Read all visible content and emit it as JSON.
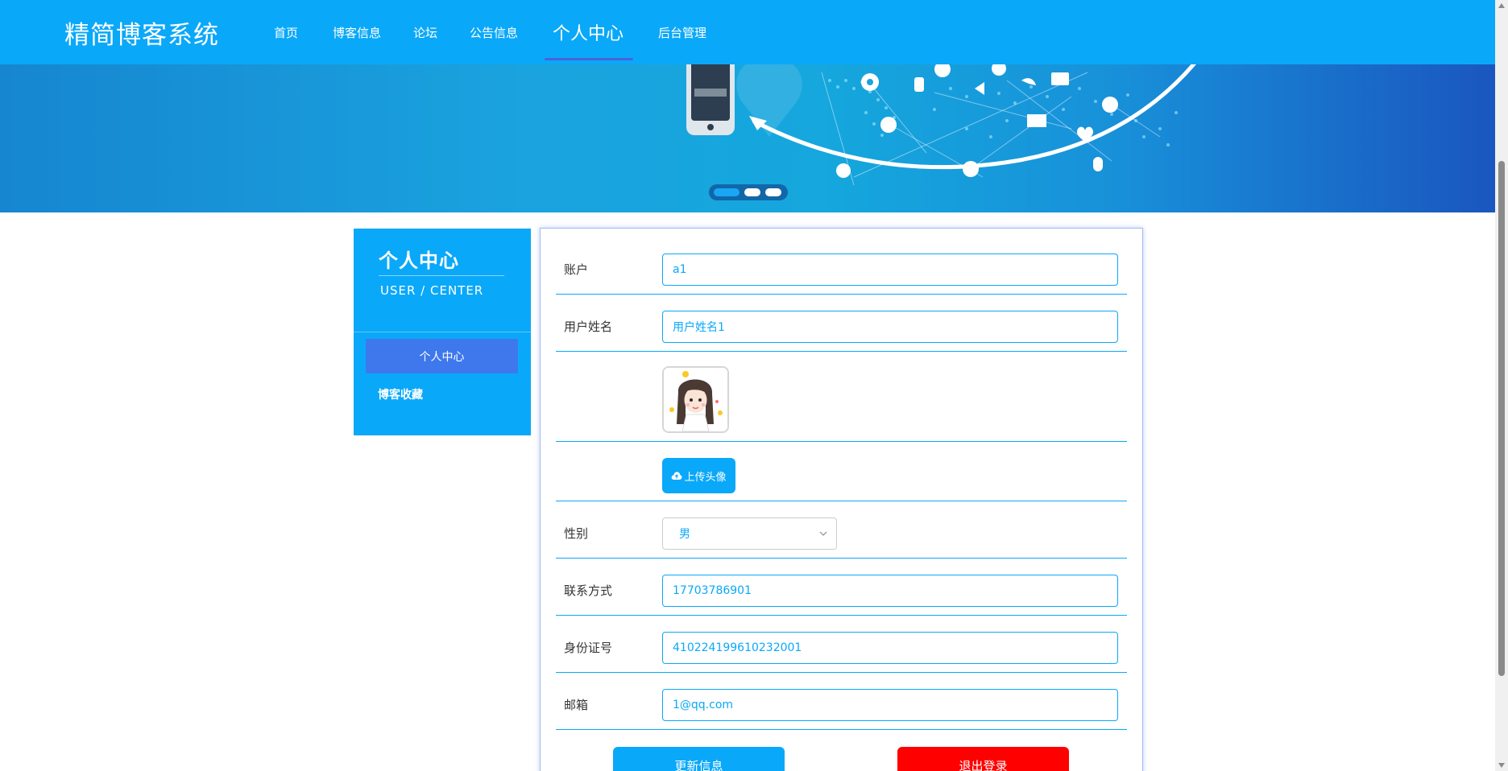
{
  "nav": {
    "brand": "精简博客系统",
    "items": [
      {
        "label": "首页"
      },
      {
        "label": "博客信息"
      },
      {
        "label": "论坛"
      },
      {
        "label": "公告信息"
      },
      {
        "label": "个人中心"
      },
      {
        "label": "后台管理"
      }
    ],
    "active_index": 4
  },
  "carousel": {
    "slide_count": 3,
    "active_slide": 1
  },
  "sidebar": {
    "title": "个人中心",
    "subtitle": "USER / CENTER",
    "items": [
      {
        "label": "个人中心",
        "active": true
      },
      {
        "label": "博客收藏",
        "active": false
      }
    ]
  },
  "form": {
    "account": {
      "label": "账户",
      "value": "a1"
    },
    "name": {
      "label": "用户姓名",
      "value": "用户姓名1"
    },
    "avatar": {
      "icon": "avatar-image"
    },
    "upload": {
      "label": "上传头像",
      "icon": "cloud-upload-icon"
    },
    "gender": {
      "label": "性别",
      "value": "男"
    },
    "phone": {
      "label": "联系方式",
      "value": "17703786901"
    },
    "id_card": {
      "label": "身份证号",
      "value": "410224199610232001"
    },
    "email": {
      "label": "邮箱",
      "value": "1@qq.com"
    },
    "update_button": "更新信息",
    "logout_button": "退出登录"
  },
  "colors": {
    "primary": "#0aa8f9",
    "active_menu": "#3f78ec",
    "danger": "#ff0000"
  }
}
